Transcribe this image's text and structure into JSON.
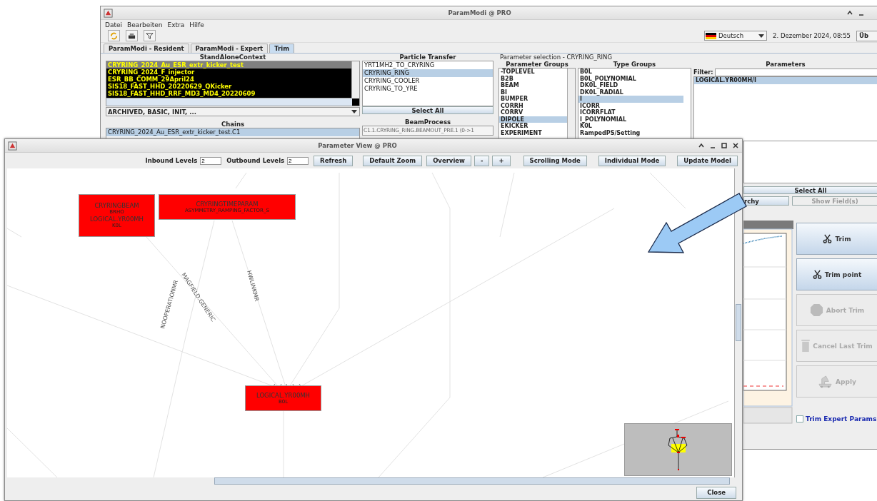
{
  "main_window": {
    "title": "ParamModi @ PRO",
    "menu": [
      "Datei",
      "Bearbeiten",
      "Extra",
      "Hilfe"
    ],
    "language": "Deutsch",
    "datetime": "2. Dezember 2024, 08:55",
    "cut_button": "Üb",
    "tabs": [
      {
        "label": "ParamModi - Resident",
        "selected": false
      },
      {
        "label": "ParamModi - Expert",
        "selected": false
      },
      {
        "label": "Trim",
        "selected": true
      }
    ],
    "standalone_context": {
      "title": "StandAloneContext",
      "filter": "ARCHIVED, BASIC, INIT, ...",
      "items": [
        {
          "label": "CRYRING_2024_Au_ESR_extr_kicker_test",
          "selected": true
        },
        {
          "label": "CRYRING_2024_F_injector",
          "selected": false
        },
        {
          "label": "ESR_BB_COMM_29April24",
          "selected": false
        },
        {
          "label": "SIS18_FAST_HHD_20220629_QKicker",
          "selected": false
        },
        {
          "label": "SIS18_FAST_HHD_RRF_MD3_MD4_20220609",
          "selected": false
        }
      ]
    },
    "particle_transfer": {
      "title": "Particle Transfer",
      "button": "Select All",
      "items": [
        {
          "label": "YRT1MH2_TO_CRYRING",
          "selected": false
        },
        {
          "label": "CRYRING_RING",
          "selected": true
        },
        {
          "label": "CRYRING_COOLER",
          "selected": false
        },
        {
          "label": "CRYRING_TO_YRE",
          "selected": false
        }
      ]
    },
    "chains": {
      "title": "Chains",
      "items": [
        {
          "label": "CRYRING_2024_Au_ESR_extr_kicker_test.C1",
          "selected": true
        }
      ]
    },
    "beam_process": {
      "title": "BeamProcess",
      "value": "C1.1.CRYRING_RING.BEAMOUT_PRE.1 (0->1",
      "disabled": true
    },
    "parameter_selection": {
      "title": "Parameter selection - CRYRING_RING",
      "groups": {
        "title": "Parameter Groups",
        "items": [
          {
            "label": "-TOPLEVEL",
            "selected": false
          },
          {
            "label": "B2B",
            "selected": false
          },
          {
            "label": "BEAM",
            "selected": false
          },
          {
            "label": "BI",
            "selected": false
          },
          {
            "label": "BUMPER",
            "selected": false
          },
          {
            "label": "CORRH",
            "selected": false
          },
          {
            "label": "CORRV",
            "selected": false
          },
          {
            "label": "DIPOLE",
            "selected": true
          },
          {
            "label": "EKICKER",
            "selected": false
          },
          {
            "label": "EXPERIMENT",
            "selected": false
          }
        ]
      },
      "types": {
        "title": "Type Groups",
        "items": [
          {
            "label": "B0L",
            "selected": false
          },
          {
            "label": "B0L_POLYNOMIAL",
            "selected": false
          },
          {
            "label": "DK0L_FIELD",
            "selected": false
          },
          {
            "label": "DK0L_RADIAL",
            "selected": false
          },
          {
            "label": "I",
            "selected": true
          },
          {
            "label": "ICORR",
            "selected": false
          },
          {
            "label": "ICORRFLAT",
            "selected": false
          },
          {
            "label": "I_POLYNOMIAL",
            "selected": false
          },
          {
            "label": "K0L",
            "selected": false
          },
          {
            "label": "RampedPS/Setting",
            "selected": false
          }
        ]
      },
      "parameters": {
        "title": "Parameters",
        "filter_label": "Filter:",
        "items": [
          {
            "label": "LOGICAL.YR00MH/I",
            "selected": true
          }
        ]
      }
    },
    "lower": {
      "select_all": "Select All",
      "hierarchy_button": "rchy",
      "show_fields": {
        "label": "Show Field(s)",
        "disabled": true
      },
      "actions": [
        {
          "label": "Trim",
          "kind": "scissors",
          "disabled": false
        },
        {
          "label": "Trim point",
          "kind": "scissors",
          "disabled": false
        },
        {
          "label": "Abort Trim",
          "kind": "stop",
          "disabled": true
        },
        {
          "label": "Cancel Last Trim",
          "kind": "trash",
          "disabled": true
        },
        {
          "label": "Apply",
          "kind": "vehicle",
          "disabled": true
        }
      ],
      "expert_params": {
        "label": "Trim Expert Params",
        "checked": false
      }
    }
  },
  "parameter_view": {
    "title": "Parameter View @ PRO",
    "inbound": {
      "label": "Inbound Levels",
      "value": "2"
    },
    "outbound": {
      "label": "Outbound Levels",
      "value": "2"
    },
    "buttons": [
      "Refresh",
      "Default Zoom",
      "Overview",
      "-",
      "+",
      "Scrolling Mode",
      "Individual Mode",
      "Update Model"
    ],
    "nodes": [
      {
        "lines": [
          {
            "text": "CRYRINGBEAM",
            "kind": "name"
          },
          {
            "text": "BRHO",
            "kind": "detail"
          },
          {
            "text": "LOGICAL.YR00MH",
            "kind": "name"
          },
          {
            "text": "K0L",
            "kind": "detail"
          }
        ]
      },
      {
        "lines": [
          {
            "text": "CRYRINGTIMEPARAM",
            "kind": "name"
          },
          {
            "text": "ASYMMETRY_RAMPING_FACTOR_S",
            "kind": "detail"
          }
        ]
      },
      {
        "lines": [
          {
            "text": "LOGICAL.YR00MH",
            "kind": "name"
          },
          {
            "text": "B0L",
            "kind": "detail"
          }
        ]
      }
    ],
    "edge_labels": [
      "MAGFIELD.GENERIC",
      "NOOPERATIONMR",
      "HWLINKMR"
    ],
    "close": "Close"
  }
}
